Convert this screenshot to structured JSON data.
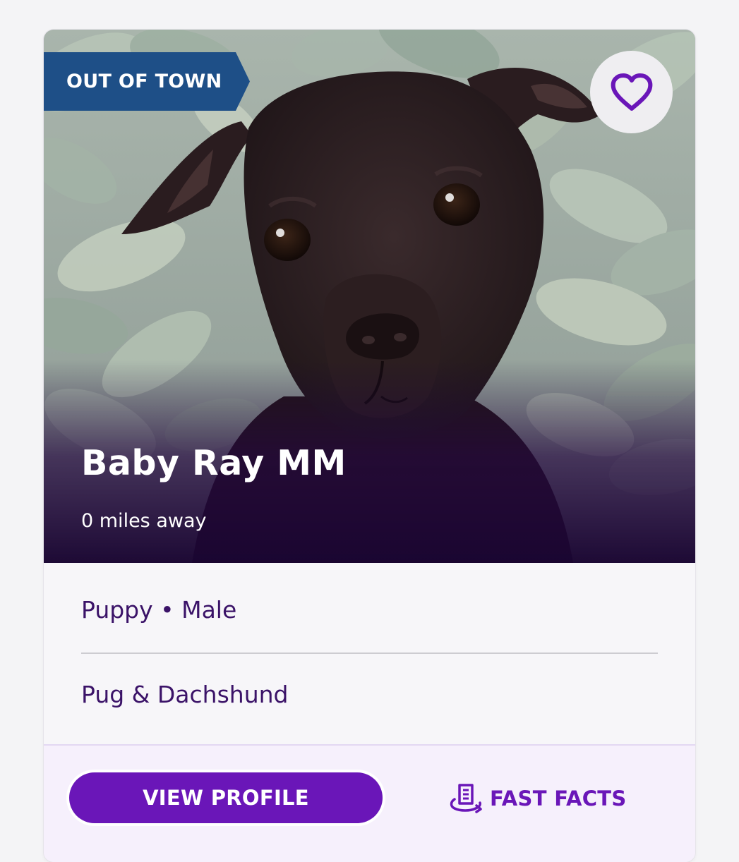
{
  "card": {
    "badge": "OUT OF TOWN",
    "name": "Baby Ray MM",
    "distance": "0 miles away",
    "age_sex": "Puppy • Male",
    "breed": "Pug & Dachshund",
    "favorite_icon": "heart-outline-icon",
    "photo_subject": "dog-photo"
  },
  "actions": {
    "view_profile": "VIEW PROFILE",
    "fast_facts": "FAST FACTS",
    "fast_facts_icon": "document-rotate-icon"
  },
  "colors": {
    "badge_bg": "#1e4f87",
    "primary_purple": "#6a16b8",
    "text_purple": "#3b1368",
    "footer_bg": "#f6f0fc",
    "photo_overlay": "#1c0636"
  }
}
